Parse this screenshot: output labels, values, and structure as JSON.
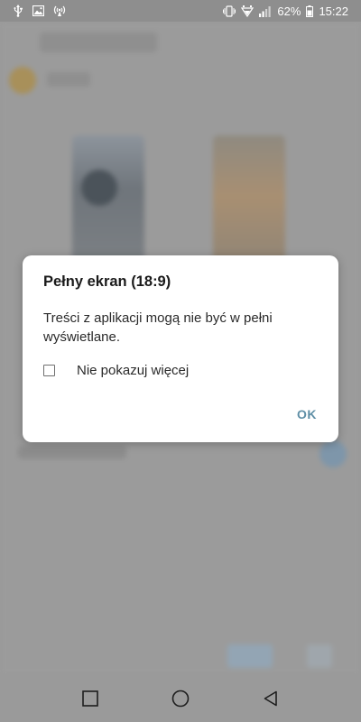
{
  "status_bar": {
    "battery": "62%",
    "time": "15:22",
    "icons_left": [
      "usb-icon",
      "image-icon",
      "wifi-hotspot-icon"
    ],
    "icons_right": [
      "vibrate-icon",
      "wifi-signal-icon",
      "cell-signal-icon",
      "battery-icon"
    ]
  },
  "dialog": {
    "title": "Pełny ekran (18:9)",
    "message": "Treści z aplikacji mogą nie być w pełni wyświetlane.",
    "checkbox_label": "Nie pokazuj więcej",
    "checkbox_checked": false,
    "ok_label": "OK"
  },
  "nav_bar": {
    "buttons": [
      "recents-icon",
      "home-icon",
      "back-icon"
    ]
  },
  "colors": {
    "accent": "#5f8fa6",
    "scrim": "#9a9a9a",
    "dialog_bg": "#ffffff"
  }
}
